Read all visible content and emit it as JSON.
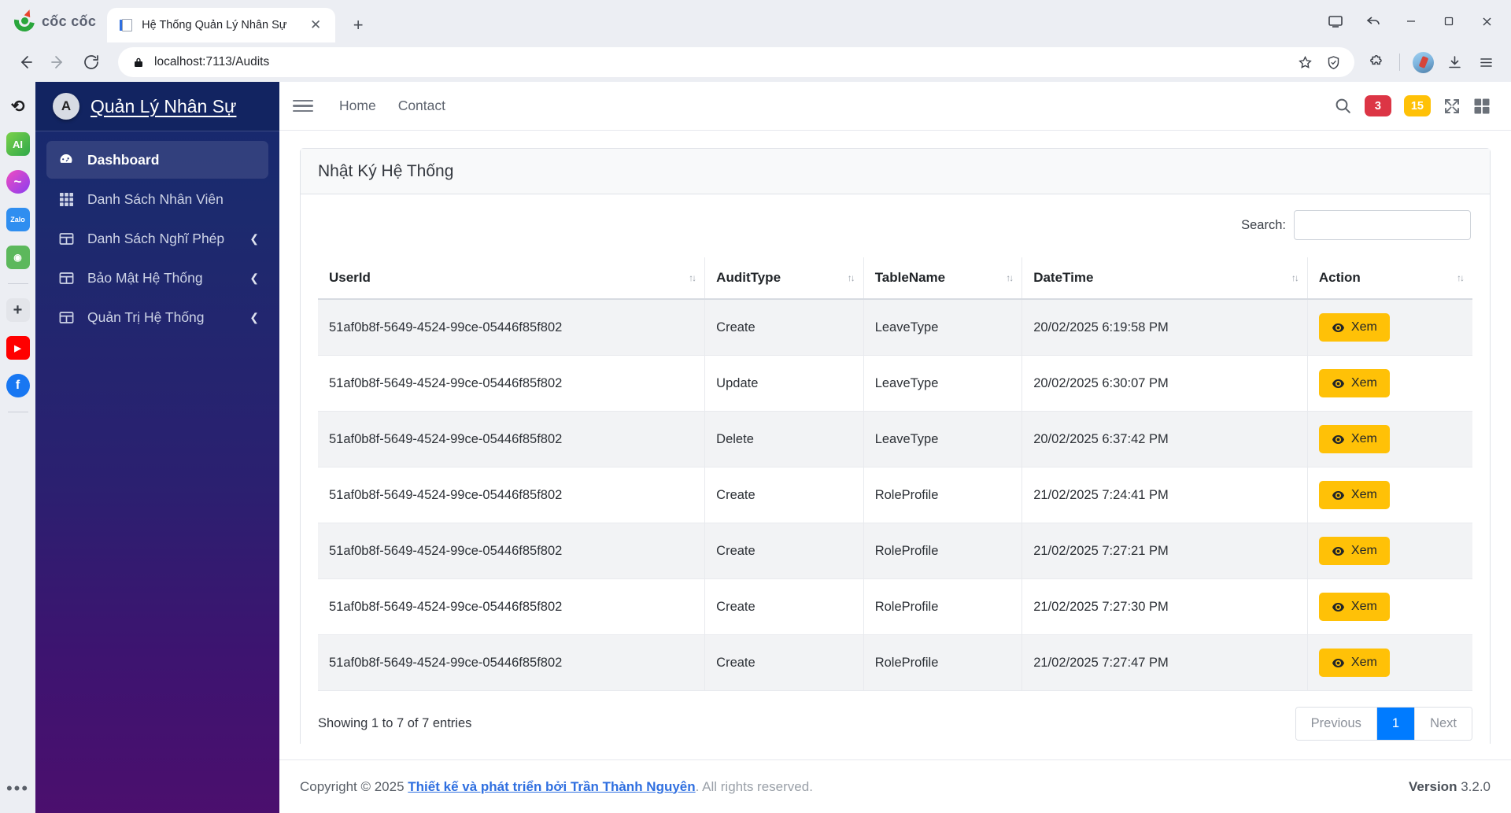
{
  "browser": {
    "brand_name": "cốc cốc",
    "tab": {
      "title": "Hệ Thống Quản Lý Nhân Sự",
      "favicon": "page-icon",
      "close": "✕"
    },
    "new_tab_label": "+",
    "window_controls": {
      "cast": "cast-icon",
      "back_arrow": "share-back-icon",
      "minimize": "—",
      "maximize": "▢",
      "close": "✕"
    },
    "nav": {
      "back": "←",
      "forward": "→",
      "reload": "⟳"
    },
    "omnibox": {
      "lock_icon": "lock-icon",
      "url": "localhost:7113/Audits",
      "star_icon": "star-icon",
      "shield_icon": "shield-icon",
      "extensions_icon": "puzzle-icon",
      "profile_icon": "avatar-icon",
      "download_icon": "download-icon",
      "menu_icon": "hamburger-menu-icon"
    },
    "dock": [
      {
        "name": "history",
        "label": "⟲",
        "color": "#ffffff",
        "text": "#1d1d1f"
      },
      {
        "name": "ai",
        "label": "AI",
        "color": "#3ec23e",
        "text": "#ffffff"
      },
      {
        "name": "messenger",
        "label": "~",
        "color": "#b043ff",
        "text": "#ffffff"
      },
      {
        "name": "zalo",
        "label": "Zalo",
        "color": "#2f8ef0",
        "text": "#ffffff"
      },
      {
        "name": "games",
        "label": "◉",
        "color": "#5cb85c",
        "text": "#ffffff"
      },
      {
        "name": "add",
        "label": "+",
        "color": "#e3e5ea",
        "text": "#3a3f47"
      },
      {
        "name": "youtube",
        "label": "▶",
        "color": "#ff0000",
        "text": "#ffffff"
      },
      {
        "name": "facebook",
        "label": "f",
        "color": "#1877f2",
        "text": "#ffffff"
      }
    ],
    "dock_more": "•••"
  },
  "sidebar": {
    "brand": {
      "logo_glyph": "A",
      "title": "Quản Lý Nhân Sự"
    },
    "items": [
      {
        "label": "Dashboard",
        "icon": "speedometer-icon",
        "active": true,
        "chevron": ""
      },
      {
        "label": "Danh Sách Nhân Viên",
        "icon": "grid-icon",
        "active": false,
        "chevron": ""
      },
      {
        "label": "Danh Sách Nghĩ Phép",
        "icon": "table-icon",
        "active": false,
        "chevron": "❮"
      },
      {
        "label": "Bảo Mật Hệ Thống",
        "icon": "table-icon",
        "active": false,
        "chevron": "❮"
      },
      {
        "label": "Quản Trị Hệ Thống",
        "icon": "table-icon",
        "active": false,
        "chevron": "❮"
      }
    ]
  },
  "topnav": {
    "toggle_icon": "hamburger-icon",
    "links": [
      "Home",
      "Contact"
    ],
    "search_icon": "search-icon",
    "badges": [
      {
        "value": "3",
        "color": "#dc3545"
      },
      {
        "value": "15",
        "color": "#ffc107"
      }
    ],
    "fullscreen_icon": "fullscreen-icon",
    "apps_icon": "apps-grid-icon"
  },
  "card": {
    "title": "Nhật Ký Hệ Thống",
    "search": {
      "label": "Search:",
      "value": "",
      "placeholder": ""
    }
  },
  "table": {
    "columns": [
      "UserId",
      "AuditType",
      "TableName",
      "DateTime",
      "Action"
    ],
    "sort_glyph": "↑↓",
    "action_button": {
      "label": "Xem",
      "icon": "eye-icon",
      "color": "#ffc107"
    },
    "rows": [
      {
        "userId": "51af0b8f-5649-4524-99ce-05446f85f802",
        "auditType": "Create",
        "tableName": "LeaveType",
        "dateTime": "20/02/2025 6:19:58 PM"
      },
      {
        "userId": "51af0b8f-5649-4524-99ce-05446f85f802",
        "auditType": "Update",
        "tableName": "LeaveType",
        "dateTime": "20/02/2025 6:30:07 PM"
      },
      {
        "userId": "51af0b8f-5649-4524-99ce-05446f85f802",
        "auditType": "Delete",
        "tableName": "LeaveType",
        "dateTime": "20/02/2025 6:37:42 PM"
      },
      {
        "userId": "51af0b8f-5649-4524-99ce-05446f85f802",
        "auditType": "Create",
        "tableName": "RoleProfile",
        "dateTime": "21/02/2025 7:24:41 PM"
      },
      {
        "userId": "51af0b8f-5649-4524-99ce-05446f85f802",
        "auditType": "Create",
        "tableName": "RoleProfile",
        "dateTime": "21/02/2025 7:27:21 PM"
      },
      {
        "userId": "51af0b8f-5649-4524-99ce-05446f85f802",
        "auditType": "Create",
        "tableName": "RoleProfile",
        "dateTime": "21/02/2025 7:27:30 PM"
      },
      {
        "userId": "51af0b8f-5649-4524-99ce-05446f85f802",
        "auditType": "Create",
        "tableName": "RoleProfile",
        "dateTime": "21/02/2025 7:27:47 PM"
      }
    ],
    "info": "Showing 1 to 7 of 7 entries",
    "pagination": {
      "previous": "Previous",
      "current": "1",
      "next": "Next"
    }
  },
  "footer": {
    "copyright_prefix": "Copyright © 2025 ",
    "link": "Thiết kế và phát triển bởi Trần Thành Nguyên",
    "copyright_suffix": ". All rights reserved.",
    "version_label": "Version",
    "version_value": "3.2.0"
  }
}
